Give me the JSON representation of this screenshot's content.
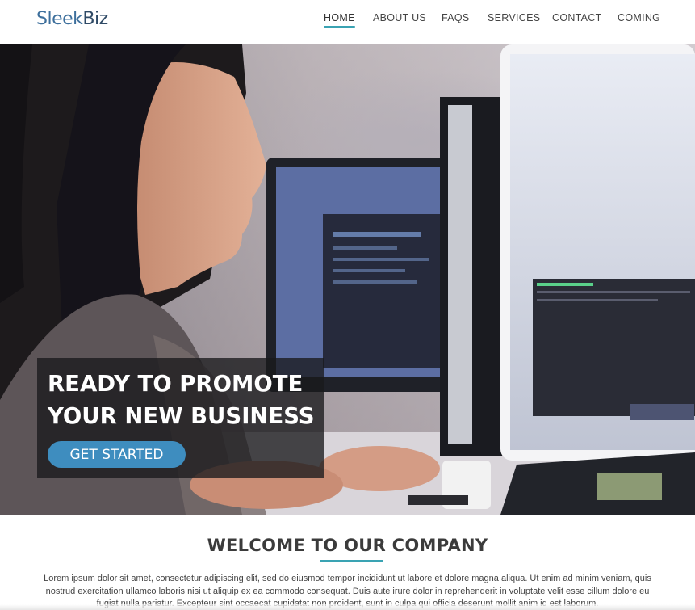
{
  "header": {
    "logo_part1": "Sleek",
    "logo_part2": "Biz",
    "nav": [
      {
        "label": "HOME",
        "active": true
      },
      {
        "label": "ABOUT US",
        "active": false
      },
      {
        "label": "FAQS",
        "active": false
      },
      {
        "label": "SERVICES",
        "active": false
      },
      {
        "label": "CONTACT",
        "active": false
      },
      {
        "label": "COMING",
        "active": false
      }
    ]
  },
  "hero": {
    "title_line1": "READY TO PROMOTE",
    "title_line2": "YOUR NEW BUSINESS",
    "cta_label": "GET STARTED",
    "image_description_icon": "office-worker-photo"
  },
  "welcome": {
    "title": "WELCOME TO OUR COMPANY",
    "text": "Lorem ipsum dolor sit amet, consectetur adipiscing elit, sed do eiusmod tempor incididunt ut labore et dolore magna aliqua. Ut enim ad minim veniam, quis nostrud exercitation ullamco laboris nisi ut aliquip ex ea commodo consequat. Duis aute irure dolor in reprehenderit in voluptate velit esse cillum dolore eu fugiat nulla pariatur. Excepteur sint occaecat cupidatat non proident, sunt in culpa qui officia deserunt mollit anim id est laborum."
  },
  "colors": {
    "accent": "#3aa3b3",
    "button": "#3e8dbf",
    "logo_primary": "#3d6f9c",
    "logo_secondary": "#2f4a66"
  }
}
